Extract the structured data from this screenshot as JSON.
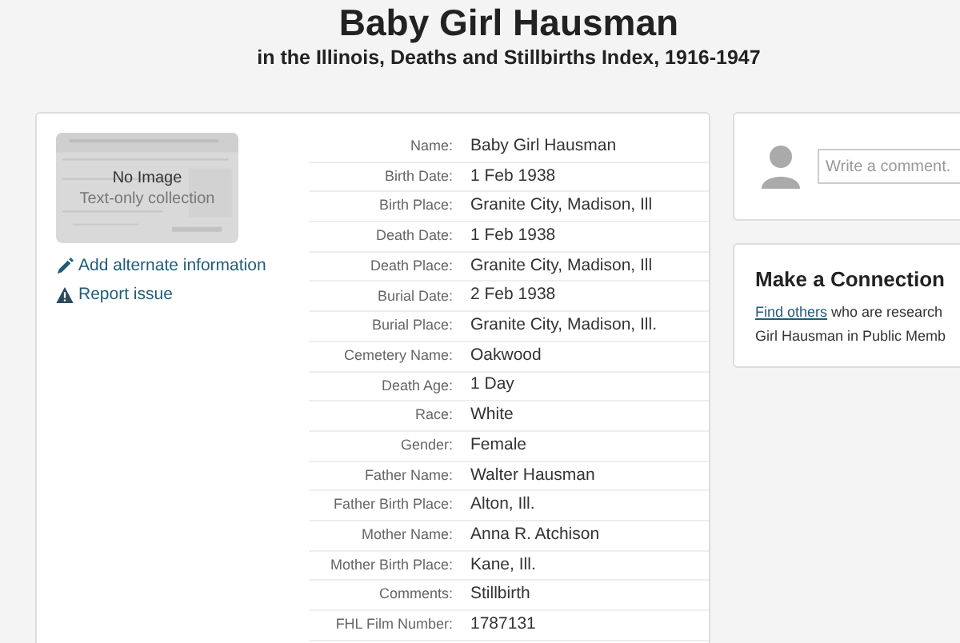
{
  "header": {
    "title": "Baby Girl Hausman",
    "subtitle": "in the Illinois, Deaths and Stillbirths Index, 1916-1947"
  },
  "record": {
    "image": {
      "title": "No Image",
      "caption": "Text-only collection"
    },
    "actions": [
      {
        "kind": "pencil",
        "label": "Add alternate information"
      },
      {
        "kind": "warning",
        "label": "Report issue"
      }
    ],
    "fields": [
      {
        "label": "Name:",
        "value": "Baby Girl Hausman"
      },
      {
        "label": "Birth Date:",
        "value": "1 Feb 1938"
      },
      {
        "label": "Birth Place:",
        "value": "Granite City, Madison, Ill"
      },
      {
        "label": "Death Date:",
        "value": "1 Feb 1938"
      },
      {
        "label": "Death Place:",
        "value": "Granite City, Madison, Ill"
      },
      {
        "label": "Burial Date:",
        "value": "2 Feb 1938"
      },
      {
        "label": "Burial Place:",
        "value": "Granite City, Madison, Ill."
      },
      {
        "label": "Cemetery Name:",
        "value": "Oakwood"
      },
      {
        "label": "Death Age:",
        "value": "1 Day"
      },
      {
        "label": "Race:",
        "value": "White"
      },
      {
        "label": "Gender:",
        "value": "Female"
      },
      {
        "label": "Father Name:",
        "value": "Walter Hausman"
      },
      {
        "label": "Father Birth Place:",
        "value": "Alton, Ill."
      },
      {
        "label": "Mother Name:",
        "value": "Anna R. Atchison"
      },
      {
        "label": "Mother Birth Place:",
        "value": "Kane, Ill."
      },
      {
        "label": "Comments:",
        "value": "Stillbirth"
      },
      {
        "label": "FHL Film Number:",
        "value": "1787131"
      }
    ]
  },
  "comment": {
    "placeholder": "Write a comment."
  },
  "connection": {
    "title": "Make a Connection",
    "link": "Find others",
    "text_1": " who are research",
    "text_2": "Girl Hausman in Public Memb"
  }
}
